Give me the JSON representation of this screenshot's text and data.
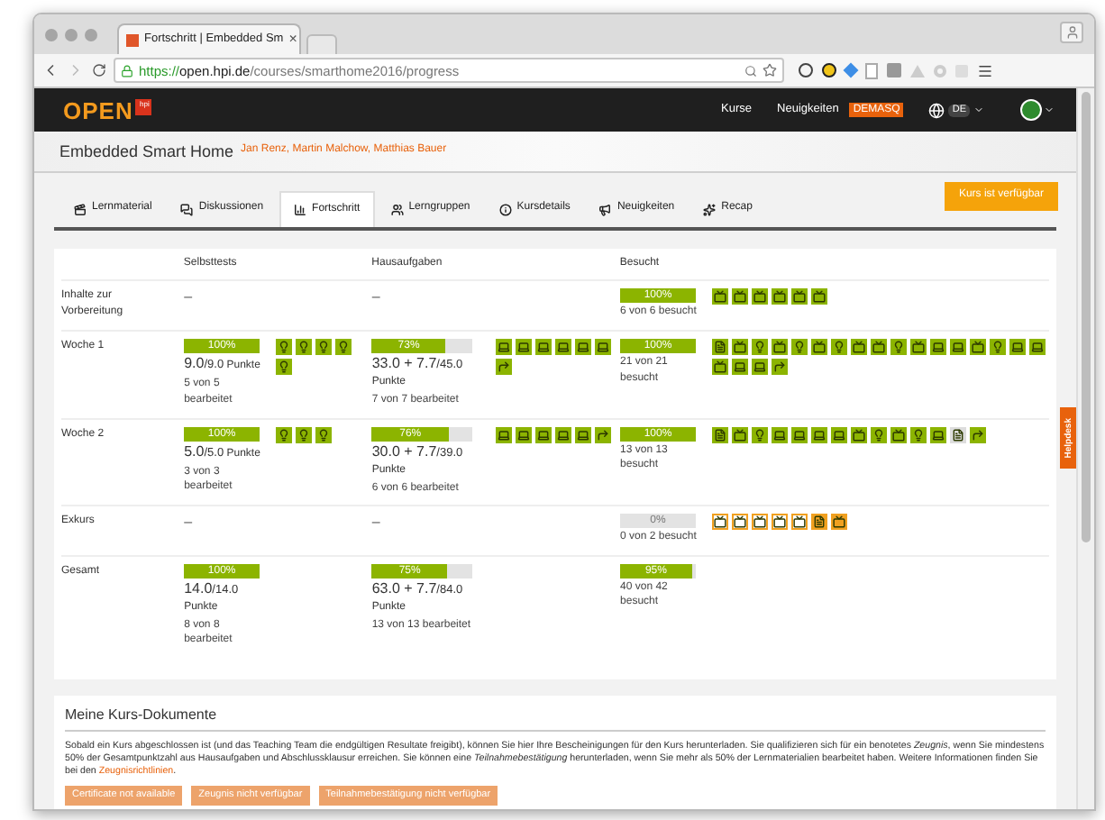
{
  "browser": {
    "tab_title": "Fortschritt | Embedded Sm",
    "tab_close": "×",
    "url_scheme": "https://",
    "url_host": "open.hpi.de",
    "url_path": "/courses/smarthome2016/progress"
  },
  "header": {
    "logo": "OPEN",
    "logo_badge": "hpi",
    "nav": [
      "Kurse",
      "Neuigkeiten"
    ],
    "badge": "DEMASQ",
    "language": "DE"
  },
  "course": {
    "title": "Embedded Smart Home",
    "teachers": "Jan Renz, Martin Malchow, Matthias Bauer",
    "status_button": "Kurs ist verfügbar"
  },
  "tabs": [
    {
      "label": "Lernmaterial",
      "selected": false
    },
    {
      "label": "Diskussionen",
      "selected": false
    },
    {
      "label": "Fortschritt",
      "selected": true
    },
    {
      "label": "Lerngruppen",
      "selected": false
    },
    {
      "label": "Kursdetails",
      "selected": false
    },
    {
      "label": "Neuigkeiten",
      "selected": false
    },
    {
      "label": "Recap",
      "selected": false
    }
  ],
  "table": {
    "columns": [
      "Selbsttests",
      "Hausaufgaben",
      "Besucht"
    ],
    "rows": [
      {
        "label": "Inhalte zur Vorbereitung",
        "cells": [
          {
            "kind": "dash",
            "text": "–"
          },
          {
            "kind": "dash",
            "text": "–"
          },
          {
            "kind": "progress",
            "percent": "100%",
            "level": 1,
            "count": "6 von 6 besucht",
            "items": [
              {
                "kind": "tv",
                "color": "#8cb400",
                "visited": true
              },
              {
                "kind": "tv",
                "color": "#8cb400",
                "visited": true
              },
              {
                "kind": "tv",
                "color": "#8cb400",
                "visited": true
              },
              {
                "kind": "tv",
                "color": "#8cb400",
                "visited": true
              },
              {
                "kind": "tv",
                "color": "#8cb400",
                "visited": true
              },
              {
                "kind": "tv",
                "color": "#8cb400",
                "visited": true
              }
            ]
          }
        ]
      },
      {
        "label": "Woche 1",
        "cells": [
          {
            "kind": "progress",
            "percent": "100%",
            "level": 1,
            "score": "9.0",
            "max": "/9.0",
            "unit": "Punkte",
            "count": "5 von 5 bearbeitet",
            "items": [
              {
                "kind": "bulb",
                "color": "#8cb400",
                "visited": true
              },
              {
                "kind": "bulb",
                "color": "#8cb400",
                "visited": true
              },
              {
                "kind": "bulb",
                "color": "#8cb400",
                "visited": true
              },
              {
                "kind": "bulb",
                "color": "#8cb400",
                "visited": true
              },
              {
                "kind": "bulb",
                "color": "#8cb400",
                "visited": true
              }
            ]
          },
          {
            "kind": "progress",
            "percent": "73%",
            "level": 0.73,
            "score": "33.0 + 7.7",
            "max": "/45.0",
            "unit": "Punkte",
            "count": "7 von 7 bearbeitet",
            "items": [
              {
                "kind": "laptop",
                "color": "#8cb400",
                "visited": true
              },
              {
                "kind": "laptop",
                "color": "#8cb400",
                "visited": true
              },
              {
                "kind": "laptop",
                "color": "#8cb400",
                "visited": true
              },
              {
                "kind": "laptop",
                "color": "#8cb400",
                "visited": true
              },
              {
                "kind": "laptop",
                "color": "#8cb400",
                "visited": true
              },
              {
                "kind": "laptop",
                "color": "#8cb400",
                "visited": true
              },
              {
                "kind": "peer",
                "color": "#8cb400",
                "visited": true
              }
            ]
          },
          {
            "kind": "progress",
            "percent": "100%",
            "level": 1,
            "count": "21 von 21 besucht",
            "items": [
              {
                "kind": "doc",
                "color": "#8cb400",
                "visited": true
              },
              {
                "kind": "tv",
                "color": "#8cb400",
                "visited": true
              },
              {
                "kind": "bulb",
                "color": "#8cb400",
                "visited": true
              },
              {
                "kind": "tv",
                "color": "#8cb400",
                "visited": true
              },
              {
                "kind": "bulb",
                "color": "#8cb400",
                "visited": true
              },
              {
                "kind": "tv",
                "color": "#8cb400",
                "visited": true
              },
              {
                "kind": "bulb",
                "color": "#8cb400",
                "visited": true
              },
              {
                "kind": "tv",
                "color": "#8cb400",
                "visited": true
              },
              {
                "kind": "tv",
                "color": "#8cb400",
                "visited": true
              },
              {
                "kind": "bulb",
                "color": "#8cb400",
                "visited": true
              },
              {
                "kind": "tv",
                "color": "#8cb400",
                "visited": true
              },
              {
                "kind": "laptop",
                "color": "#8cb400",
                "visited": true
              },
              {
                "kind": "laptop",
                "color": "#8cb400",
                "visited": true
              },
              {
                "kind": "tv",
                "color": "#8cb400",
                "visited": true
              },
              {
                "kind": "bulb",
                "color": "#8cb400",
                "visited": true
              },
              {
                "kind": "laptop",
                "color": "#8cb400",
                "visited": true
              },
              {
                "kind": "laptop",
                "color": "#8cb400",
                "visited": true
              },
              {
                "kind": "tv",
                "color": "#8cb400",
                "visited": true
              },
              {
                "kind": "laptop",
                "color": "#8cb400",
                "visited": true
              },
              {
                "kind": "laptop",
                "color": "#8cb400",
                "visited": true
              },
              {
                "kind": "peer",
                "color": "#8cb400",
                "visited": true
              }
            ]
          }
        ]
      },
      {
        "label": "Woche 2",
        "cells": [
          {
            "kind": "progress",
            "percent": "100%",
            "level": 1,
            "score": "5.0",
            "max": "/5.0",
            "unit": "Punkte",
            "count": "3 von 3 bearbeitet",
            "items": [
              {
                "kind": "bulb",
                "color": "#8cb400",
                "visited": true
              },
              {
                "kind": "bulb",
                "color": "#8cb400",
                "visited": true
              },
              {
                "kind": "bulb",
                "color": "#8cb400",
                "visited": true
              }
            ]
          },
          {
            "kind": "progress",
            "percent": "76%",
            "level": 0.76,
            "score": "30.0 + 7.7",
            "max": "/39.0",
            "unit": "Punkte",
            "count": "6 von 6 bearbeitet",
            "items": [
              {
                "kind": "laptop",
                "color": "#8cb400",
                "visited": true
              },
              {
                "kind": "laptop",
                "color": "#8cb400",
                "visited": true
              },
              {
                "kind": "laptop",
                "color": "#8cb400",
                "visited": true
              },
              {
                "kind": "laptop",
                "color": "#8cb400",
                "visited": true
              },
              {
                "kind": "laptop",
                "color": "#8cb400",
                "visited": true
              },
              {
                "kind": "peer",
                "color": "#8cb400",
                "visited": true
              }
            ]
          },
          {
            "kind": "progress",
            "percent": "100%",
            "level": 1,
            "count": "13 von 13 besucht",
            "items": [
              {
                "kind": "doc",
                "color": "#8cb400",
                "visited": true
              },
              {
                "kind": "tv",
                "color": "#8cb400",
                "visited": true
              },
              {
                "kind": "bulb",
                "color": "#8cb400",
                "visited": true
              },
              {
                "kind": "laptop",
                "color": "#8cb400",
                "visited": true
              },
              {
                "kind": "laptop",
                "color": "#8cb400",
                "visited": true
              },
              {
                "kind": "laptop",
                "color": "#8cb400",
                "visited": true
              },
              {
                "kind": "laptop",
                "color": "#8cb400",
                "visited": true
              },
              {
                "kind": "tv",
                "color": "#8cb400",
                "visited": true
              },
              {
                "kind": "bulb",
                "color": "#8cb400",
                "visited": true
              },
              {
                "kind": "tv",
                "color": "#8cb400",
                "visited": true
              },
              {
                "kind": "bulb",
                "color": "#8cb400",
                "visited": true
              },
              {
                "kind": "laptop",
                "color": "#8cb400",
                "visited": true
              },
              {
                "kind": "doc",
                "color": "#dddddd",
                "visited": true
              },
              {
                "kind": "peer",
                "color": "#8cb400",
                "visited": true
              }
            ]
          }
        ]
      },
      {
        "label": "Exkurs",
        "cells": [
          {
            "kind": "dash",
            "text": "–"
          },
          {
            "kind": "dash",
            "text": "–"
          },
          {
            "kind": "progress",
            "percent": "0%",
            "level": 0,
            "count": "0 von 2 besucht",
            "items": [
              {
                "kind": "tv",
                "color": "#f0a020",
                "visited": false
              },
              {
                "kind": "tv",
                "color": "#f0a020",
                "visited": false
              },
              {
                "kind": "tv",
                "color": "#f0a020",
                "visited": false
              },
              {
                "kind": "tv",
                "color": "#f0a020",
                "visited": false
              },
              {
                "kind": "tv",
                "color": "#f0a020",
                "visited": false
              },
              {
                "kind": "doc",
                "color": "#f0a020",
                "visited": true
              },
              {
                "kind": "tv",
                "color": "#f0a020",
                "visited": true
              }
            ]
          }
        ]
      },
      {
        "label": "Gesamt",
        "cells": [
          {
            "kind": "progress",
            "percent": "100%",
            "level": 1,
            "score": "14.0",
            "max": "/14.0",
            "unit": "Punkte",
            "count": "8 von 8 bearbeitet"
          },
          {
            "kind": "progress",
            "percent": "75%",
            "level": 0.75,
            "score": "63.0 + 7.7",
            "max": "/84.0",
            "unit": "Punkte",
            "count": "13 von 13 bearbeitet"
          },
          {
            "kind": "progress",
            "percent": "95%",
            "level": 0.95,
            "count": "40 von 42 besucht"
          }
        ]
      }
    ]
  },
  "documents": {
    "title": "Meine Kurs-Dokumente",
    "text": "Sobald ein Kurs abgeschlossen ist (und das Teaching Team die endgültigen Resultate freigibt), können Sie hier Ihre Bescheinigungen für den Kurs herunterladen. Sie qualifizieren sich für ein benotetes *Zeugnis*, wenn Sie mindestens 50% der Gesamtpunktzahl aus Hausaufgaben und Abschlussklausur erreichen. Sie können eine *Teilnahmebestätigung* herunterladen, wenn Sie mehr als 50% der Lernmaterialien bearbeitet haben. Weitere Informationen finden Sie bei den",
    "link": "Zeugnisrichtlinien",
    "link_end": ".",
    "buttons": [
      "Certificate not available",
      "Zeugnis nicht verfügbar",
      "Teilnahmebestätigung nicht verfügbar"
    ]
  },
  "helpdesk": "Helpdesk"
}
